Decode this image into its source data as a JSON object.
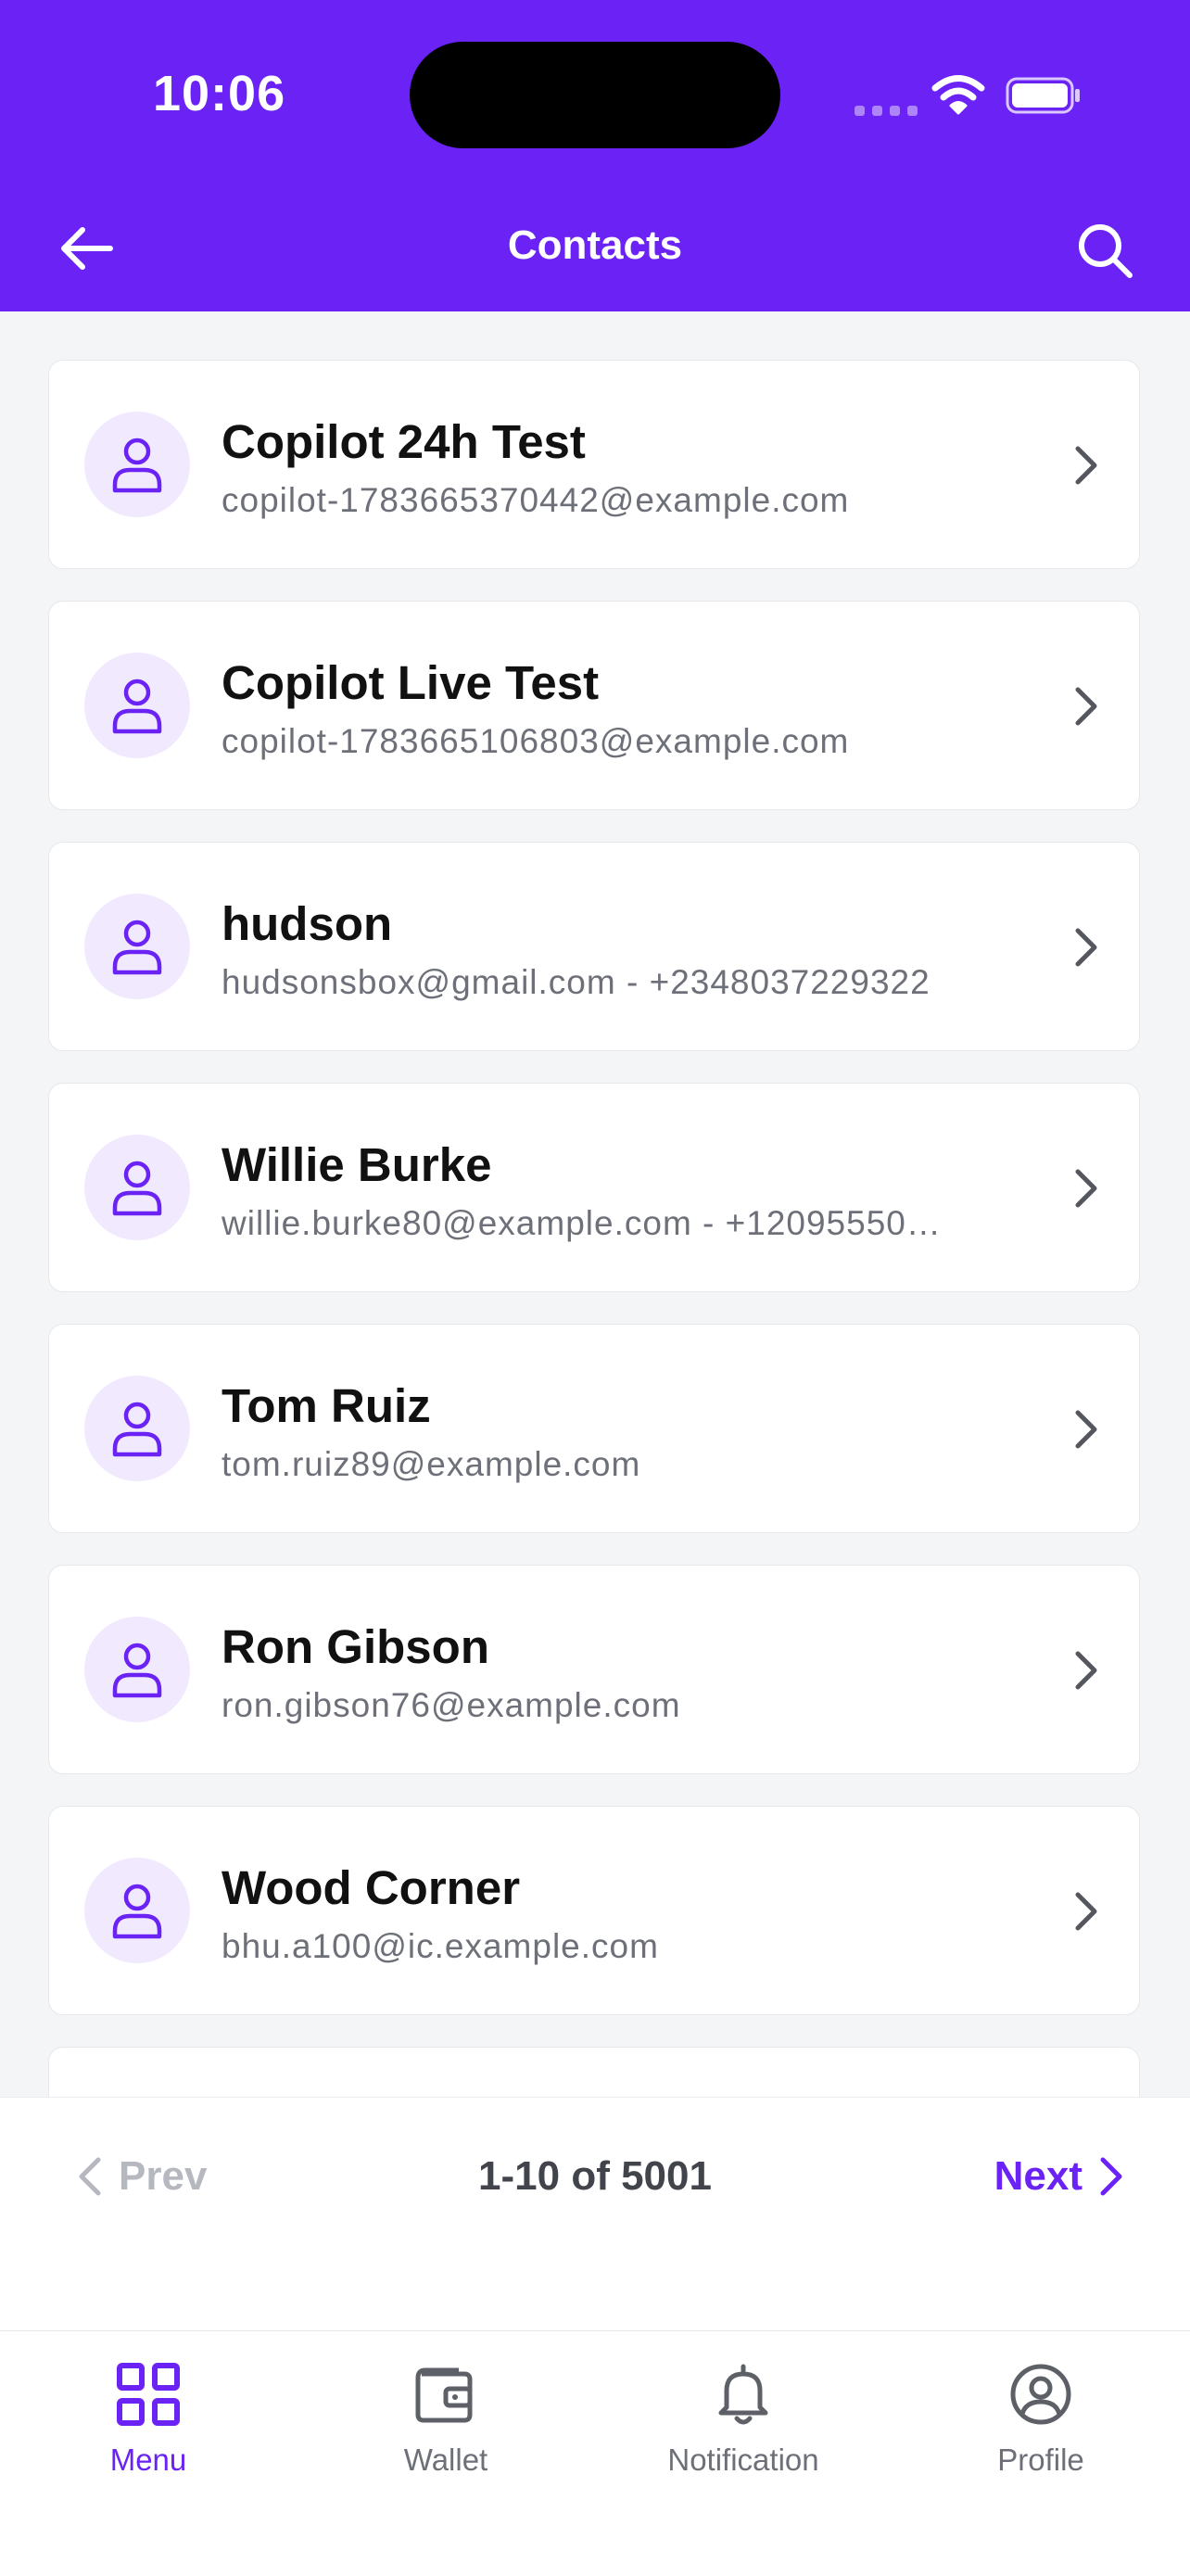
{
  "status_bar": {
    "time": "10:06"
  },
  "header": {
    "title": "Contacts"
  },
  "contacts": [
    {
      "name": "Copilot 24h Test",
      "detail": "copilot-1783665370442@example.com"
    },
    {
      "name": "Copilot Live Test",
      "detail": "copilot-1783665106803@example.com"
    },
    {
      "name": "hudson",
      "detail": "hudsonsbox@gmail.com - +2348037229322"
    },
    {
      "name": "Willie Burke",
      "detail": "willie.burke80@example.com - +12095550…"
    },
    {
      "name": "Tom Ruiz",
      "detail": "tom.ruiz89@example.com"
    },
    {
      "name": "Ron Gibson",
      "detail": "ron.gibson76@example.com"
    },
    {
      "name": "Wood Corner",
      "detail": "bhu.a100@ic.example.com"
    }
  ],
  "pagination": {
    "prev_label": "Prev",
    "range_text": "1-10 of 5001",
    "next_label": "Next"
  },
  "bottom_nav": [
    {
      "label": "Menu",
      "icon": "grid-icon",
      "active": true
    },
    {
      "label": "Wallet",
      "icon": "wallet-icon",
      "active": false
    },
    {
      "label": "Notification",
      "icon": "bell-icon",
      "active": false
    },
    {
      "label": "Profile",
      "icon": "profile-icon",
      "active": false
    }
  ],
  "colors": {
    "brand": "#6A22F5",
    "avatar_bg": "#F1E9FE",
    "muted_text": "#6E7079",
    "disabled": "#B6B8BF"
  }
}
